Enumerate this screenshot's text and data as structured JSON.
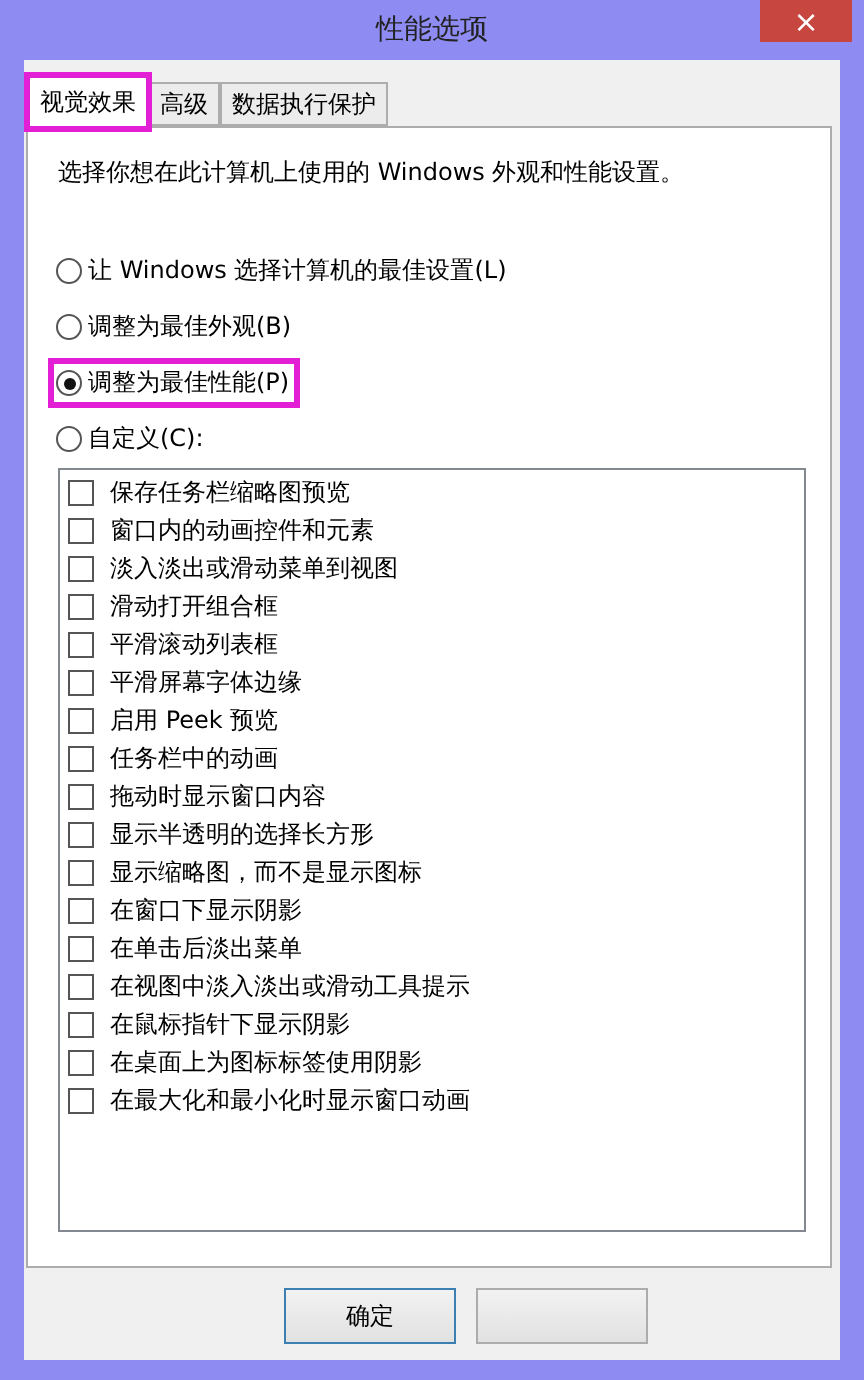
{
  "window": {
    "title": "性能选项",
    "close": "×"
  },
  "tabs": [
    {
      "label": "视觉效果",
      "selected": true,
      "highlighted": true
    },
    {
      "label": "高级",
      "selected": false,
      "highlighted": false
    },
    {
      "label": "数据执行保护",
      "selected": false,
      "highlighted": false
    }
  ],
  "intro": "选择你想在此计算机上使用的 Windows 外观和性能设置。",
  "options": [
    {
      "label": "让 Windows 选择计算机的最佳设置(L)",
      "selected": false,
      "highlighted": false
    },
    {
      "label": "调整为最佳外观(B)",
      "selected": false,
      "highlighted": false
    },
    {
      "label": "调整为最佳性能(P)",
      "selected": true,
      "highlighted": true
    },
    {
      "label": "自定义(C):",
      "selected": false,
      "highlighted": false
    }
  ],
  "effects": [
    {
      "label": "保存任务栏缩略图预览",
      "checked": false
    },
    {
      "label": "窗口内的动画控件和元素",
      "checked": false
    },
    {
      "label": "淡入淡出或滑动菜单到视图",
      "checked": false
    },
    {
      "label": "滑动打开组合框",
      "checked": false
    },
    {
      "label": "平滑滚动列表框",
      "checked": false
    },
    {
      "label": "平滑屏幕字体边缘",
      "checked": false
    },
    {
      "label": "启用 Peek 预览",
      "checked": false
    },
    {
      "label": "任务栏中的动画",
      "checked": false
    },
    {
      "label": "拖动时显示窗口内容",
      "checked": false
    },
    {
      "label": "显示半透明的选择长方形",
      "checked": false
    },
    {
      "label": "显示缩略图，而不是显示图标",
      "checked": false
    },
    {
      "label": "在窗口下显示阴影",
      "checked": false
    },
    {
      "label": "在单击后淡出菜单",
      "checked": false
    },
    {
      "label": "在视图中淡入淡出或滑动工具提示",
      "checked": false
    },
    {
      "label": "在鼠标指针下显示阴影",
      "checked": false
    },
    {
      "label": "在桌面上为图标标签使用阴影",
      "checked": false
    },
    {
      "label": "在最大化和最小化时显示窗口动画",
      "checked": false
    }
  ],
  "buttons": [
    {
      "label": "确定",
      "kind": "default"
    },
    {
      "kind": "covered"
    }
  ]
}
